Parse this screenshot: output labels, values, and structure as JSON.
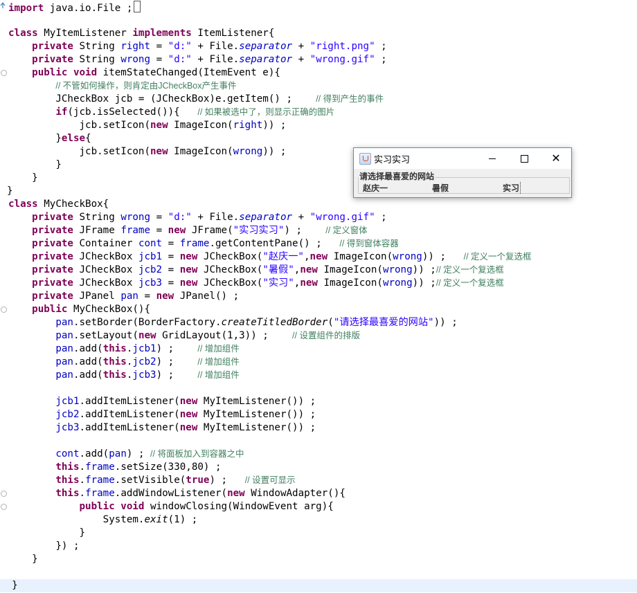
{
  "code": {
    "l1_kw": "import",
    "l1_rest": " java.io.File ;",
    "l3_kw1": "class",
    "l3_name": " MyItemListener ",
    "l3_kw2": "implements",
    "l3_rest": " ItemListener{",
    "l4": [
      "private",
      " String ",
      "right",
      " = ",
      "\"d:\"",
      " + File.",
      "separator",
      " + ",
      "\"right.png\"",
      " ;"
    ],
    "l5": [
      "private",
      " String ",
      "wrong",
      " = ",
      "\"d:\"",
      " + File.",
      "separator",
      " + ",
      "\"wrong.gif\"",
      " ;"
    ],
    "l6": [
      "public",
      " ",
      "void",
      " itemStateChanged(ItemEvent e){"
    ],
    "l7_comment": "// 不管如何操作，则肯定由JCheckBox产生事件",
    "l8_code": "JCheckBox jcb = (JCheckBox)e.getItem() ;",
    "l8_comment": "// 得到产生的事件",
    "l9_kw": "if",
    "l9_code": "(jcb.isSelected()){",
    "l9_comment": "// 如果被选中了，则显示正确的图片",
    "l10_a": "jcb.setIcon(",
    "l10_kw": "new",
    "l10_b": " ImageIcon(",
    "l10_f": "right",
    "l10_c": ")) ;",
    "l11_a": "}",
    "l11_kw": "else",
    "l11_b": "{",
    "l12_a": "jcb.setIcon(",
    "l12_kw": "new",
    "l12_b": " ImageIcon(",
    "l12_f": "wrong",
    "l12_c": ")) ;",
    "brace": "}",
    "l16_kw": "class",
    "l16_rest": " MyCheckBox{",
    "l17": [
      "private",
      " String ",
      "wrong",
      " = ",
      "\"d:\"",
      " + File.",
      "separator",
      " + ",
      "\"wrong.gif\"",
      " ;"
    ],
    "l18": [
      "private",
      " JFrame ",
      "frame",
      " = ",
      "new",
      " JFrame(",
      "\"实习实习\"",
      ") ;",
      "// 定义窗体"
    ],
    "l19": [
      "private",
      " Container ",
      "cont",
      " = ",
      "frame",
      ".getContentPane() ;",
      "// 得到窗体容器"
    ],
    "l20": [
      "private",
      " JCheckBox ",
      "jcb1",
      " = ",
      "new",
      " JCheckBox(",
      "\"赵庆一\"",
      ",",
      "new",
      " ImageIcon(",
      "wrong",
      ")) ;",
      "// 定义一个复选框"
    ],
    "l21": [
      "private",
      " JCheckBox ",
      "jcb2",
      " = ",
      "new",
      " JCheckBox(",
      "\"暑假\"",
      ",",
      "new",
      " ImageIcon(",
      "wrong",
      ")) ;",
      "// 定义一个复选框"
    ],
    "l22": [
      "private",
      " JCheckBox ",
      "jcb3",
      " = ",
      "new",
      " JCheckBox(",
      "\"实习\"",
      ",",
      "new",
      " ImageIcon(",
      "wrong",
      ")) ;",
      "// 定义一个复选框"
    ],
    "l23": [
      "private",
      " JPanel ",
      "pan",
      " = ",
      "new",
      " JPanel() ;"
    ],
    "l24": [
      "public",
      " MyCheckBox(){"
    ],
    "l25": [
      "pan",
      ".setBorder(BorderFactory.",
      "createTitledBorder",
      "(",
      "\"请选择最喜爱的网站\"",
      ")) ;"
    ],
    "l26": [
      "pan",
      ".setLayout(",
      "new",
      " GridLayout(1,3)) ;",
      "// 设置组件的排版"
    ],
    "l27": [
      "pan",
      ".add(",
      "this",
      ".",
      "jcb1",
      ") ;",
      "// 增加组件"
    ],
    "l28": [
      "pan",
      ".add(",
      "this",
      ".",
      "jcb2",
      ") ;",
      "// 增加组件"
    ],
    "l29": [
      "pan",
      ".add(",
      "this",
      ".",
      "jcb3",
      ") ;",
      "// 增加组件"
    ],
    "l31": [
      "jcb1",
      ".addItemListener(",
      "new",
      " MyItemListener()) ;"
    ],
    "l32": [
      "jcb2",
      ".addItemListener(",
      "new",
      " MyItemListener()) ;"
    ],
    "l33": [
      "jcb3",
      ".addItemListener(",
      "new",
      " MyItemListener()) ;"
    ],
    "l35": [
      "cont",
      ".add(",
      "pan",
      ") ;",
      "// 将面板加入到容器之中"
    ],
    "l36": [
      "this",
      ".",
      "frame",
      ".setSize(330,80) ;"
    ],
    "l37": [
      "this",
      ".",
      "frame",
      ".setVisible(",
      "true",
      ") ;",
      "// 设置可显示"
    ],
    "l38": [
      "this",
      ".",
      "frame",
      ".addWindowListener(",
      "new",
      " WindowAdapter(){"
    ],
    "l39": [
      "public",
      " ",
      "void",
      " windowClosing(WindowEvent arg){"
    ],
    "l40": [
      "System.",
      "exit",
      "(1) ;"
    ],
    "l42": "}) ;"
  },
  "window": {
    "title": "实习实习",
    "minimize": "—",
    "maximize": "□",
    "close": "✕",
    "panel_title": "请选择最喜爱的网站",
    "checkboxes": [
      "赵庆一",
      "暑假",
      "实习"
    ]
  }
}
